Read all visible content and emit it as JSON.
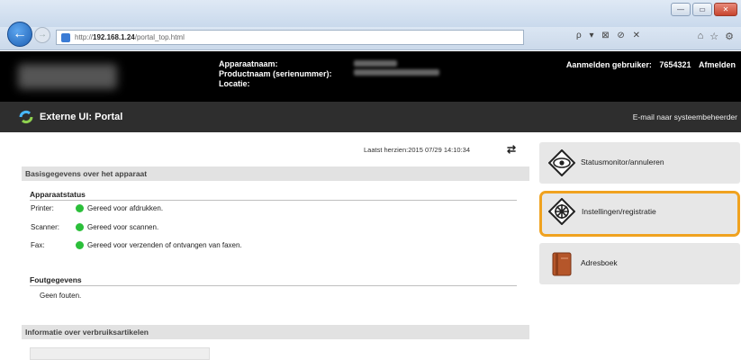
{
  "browser": {
    "url_prefix": "http://",
    "url_host": "192.168.1.24",
    "url_path": "/portal_top.html",
    "tools": "ρ ▾ ⊠ ⊘ ✕"
  },
  "header": {
    "device_name_label": "Apparaatnaam:",
    "product_name_label": "Productnaam (serienummer):",
    "location_label": "Locatie:",
    "login_user_label": "Aanmelden gebruiker:",
    "login_user_value": "7654321",
    "logout_link": "Afmelden"
  },
  "titlebar": {
    "title": "Externe UI: Portal",
    "mail_link": "E-mail naar systeembeheerder"
  },
  "content": {
    "last_refresh_label": "Laatst herzien:",
    "last_refresh_value": "2015 07/29 14:10:34",
    "basic_info_title": "Basisgegevens over het apparaat",
    "device_status_heading": "Apparaatstatus",
    "statuses": [
      {
        "device": "Printer:",
        "text": "Gereed voor afdrukken.",
        "color": "#2bbf3a"
      },
      {
        "device": "Scanner:",
        "text": "Gereed voor scannen.",
        "color": "#2bbf3a"
      },
      {
        "device": "Fax:",
        "text": "Gereed voor verzenden of ontvangen van faxen.",
        "color": "#2bbf3a"
      }
    ],
    "error_heading": "Foutgegevens",
    "error_text": "Geen fouten.",
    "consumables_title": "Informatie over verbruiksartikelen"
  },
  "menu": {
    "items": [
      {
        "label": "Statusmonitor/annuleren",
        "icon": "eye-diamond-icon"
      },
      {
        "label": "Instellingen/registratie",
        "icon": "settings-gear-icon"
      },
      {
        "label": "Adresboek",
        "icon": "address-book-icon"
      }
    ],
    "active_color": "#f0a21f"
  },
  "colors": {
    "header_bg": "#000000",
    "titlebar_bg": "#2e2e2e",
    "status_ok": "#2bbf3a"
  }
}
